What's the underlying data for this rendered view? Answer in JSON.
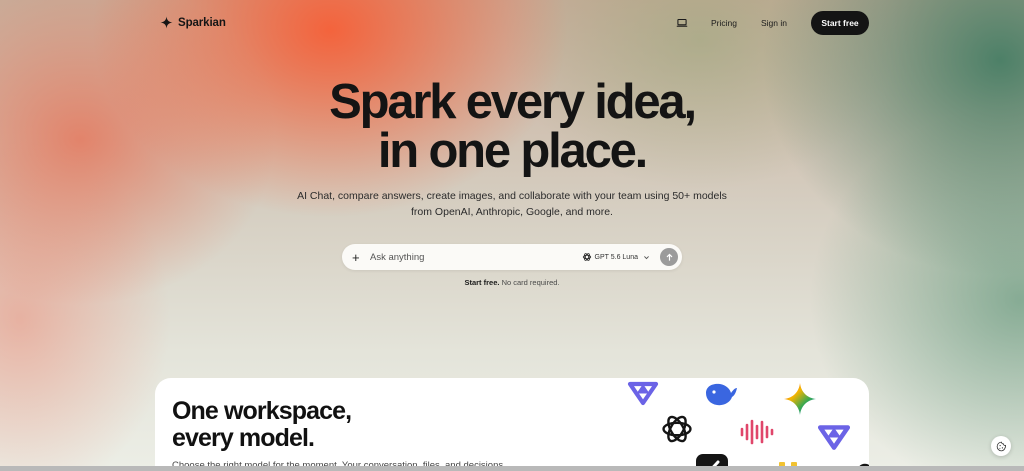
{
  "nav": {
    "brand": "Sparkian",
    "links": [
      "Pricing",
      "Sign in"
    ],
    "cta": "Start free",
    "device_icon": "laptop-icon"
  },
  "hero": {
    "title_line1": "Spark every idea,",
    "title_line2": "in one place.",
    "subtitle_line1": "AI Chat, compare answers, create images, and collaborate with your team using 50+ models",
    "subtitle_line2": "from OpenAI, Anthropic, Google, and more."
  },
  "search": {
    "placeholder": "Ask anything",
    "model": "GPT 5.6 Luna"
  },
  "note": {
    "bold": "Start free.",
    "rest": " No card required."
  },
  "workspace": {
    "title_line1": "One workspace,",
    "title_line2": "every model.",
    "description": "Choose the right model for the moment. Your conversation, files, and decisions"
  },
  "colors": {
    "accent_dark": "#141414",
    "hero_orange": "#f65f37",
    "hero_green": "#467d64",
    "logo_violet": "#6b63e6",
    "logo_blue": "#3a66e0",
    "logo_pink": "#e0466b"
  },
  "icons": [
    "spark-icon",
    "laptop-icon",
    "plus-icon",
    "openai-icon",
    "chevron-down-icon",
    "arrow-up-icon",
    "cookie-icon"
  ]
}
